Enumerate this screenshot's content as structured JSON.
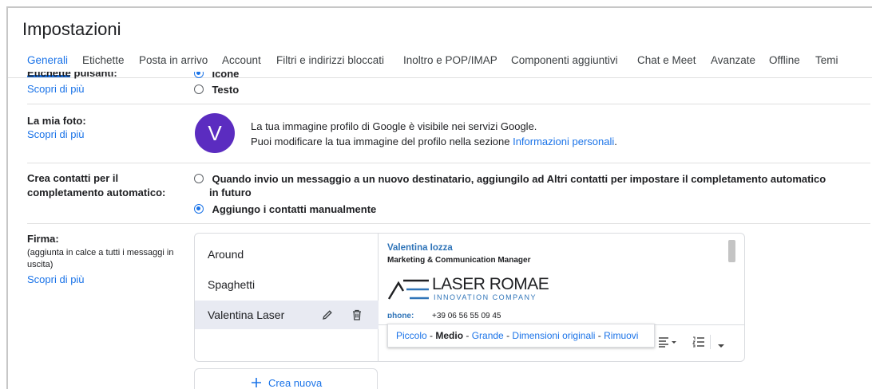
{
  "page_title": "Impostazioni",
  "tabs": [
    "Generali",
    "Etichette",
    "Posta in arrivo",
    "Account",
    "Filtri e indirizzi bloccati",
    "Inoltro e POP/IMAP",
    "Componenti aggiuntivi",
    "Chat e Meet",
    "Avanzate",
    "Offline",
    "Temi"
  ],
  "button_labels": {
    "label_cutoff": "Etichette pulsanti:",
    "learn_more": "Scopri di più",
    "icons_cutoff": "Icone",
    "text_option": "Testo"
  },
  "photo": {
    "label": "La mia foto:",
    "learn_more": "Scopri di più",
    "avatar_letter": "V",
    "line1": "La tua immagine profilo di Google è visibile nei servizi Google.",
    "line2_prefix": "Puoi modificare la tua immagine del profilo nella sezione ",
    "line2_link": "Informazioni personali",
    "line2_suffix": "."
  },
  "contacts": {
    "label_line1": "Crea contatti per il",
    "label_line2": "completamento automatico:",
    "option1_line1": "Quando invio un messaggio a un nuovo destinatario, aggiungilo ad Altri contatti per impostare il completamento automatico",
    "option1_line2": "in futuro",
    "option2": "Aggiungo i contatti manualmente",
    "selected": 2
  },
  "signature": {
    "label": "Firma:",
    "hint_line1": "(aggiunta in calce a tutti i messaggi in",
    "hint_line2": "uscita)",
    "learn_more": "Scopri di più",
    "items": [
      "Around",
      "Spaghetti",
      "Valentina Laser"
    ],
    "selected_index": 2,
    "create_new": "Crea nuova",
    "preview": {
      "name": "Valentina Iozza",
      "role": "Marketing & Communication Manager",
      "logo_main": "LASER ROMAE",
      "logo_sub": "INNOVATION COMPANY",
      "phone_label": "phone:",
      "phone_value": "+39 06 56 55 09 45"
    },
    "size_popup": {
      "small": "Piccolo",
      "medium": "Medio",
      "large": "Grande",
      "original": "Dimensioni originali",
      "remove": "Rimuovi",
      "separator": " - "
    }
  },
  "colors": {
    "accent": "#1a73e8",
    "avatar": "#5b2cc0",
    "logo_blue": "#2f74b8",
    "selected_item_bg": "#e8eaf2"
  },
  "icons": [
    "pencil-icon",
    "trash-icon",
    "plus-icon",
    "align-icon",
    "numbered-list-icon",
    "chevron-down-icon"
  ]
}
